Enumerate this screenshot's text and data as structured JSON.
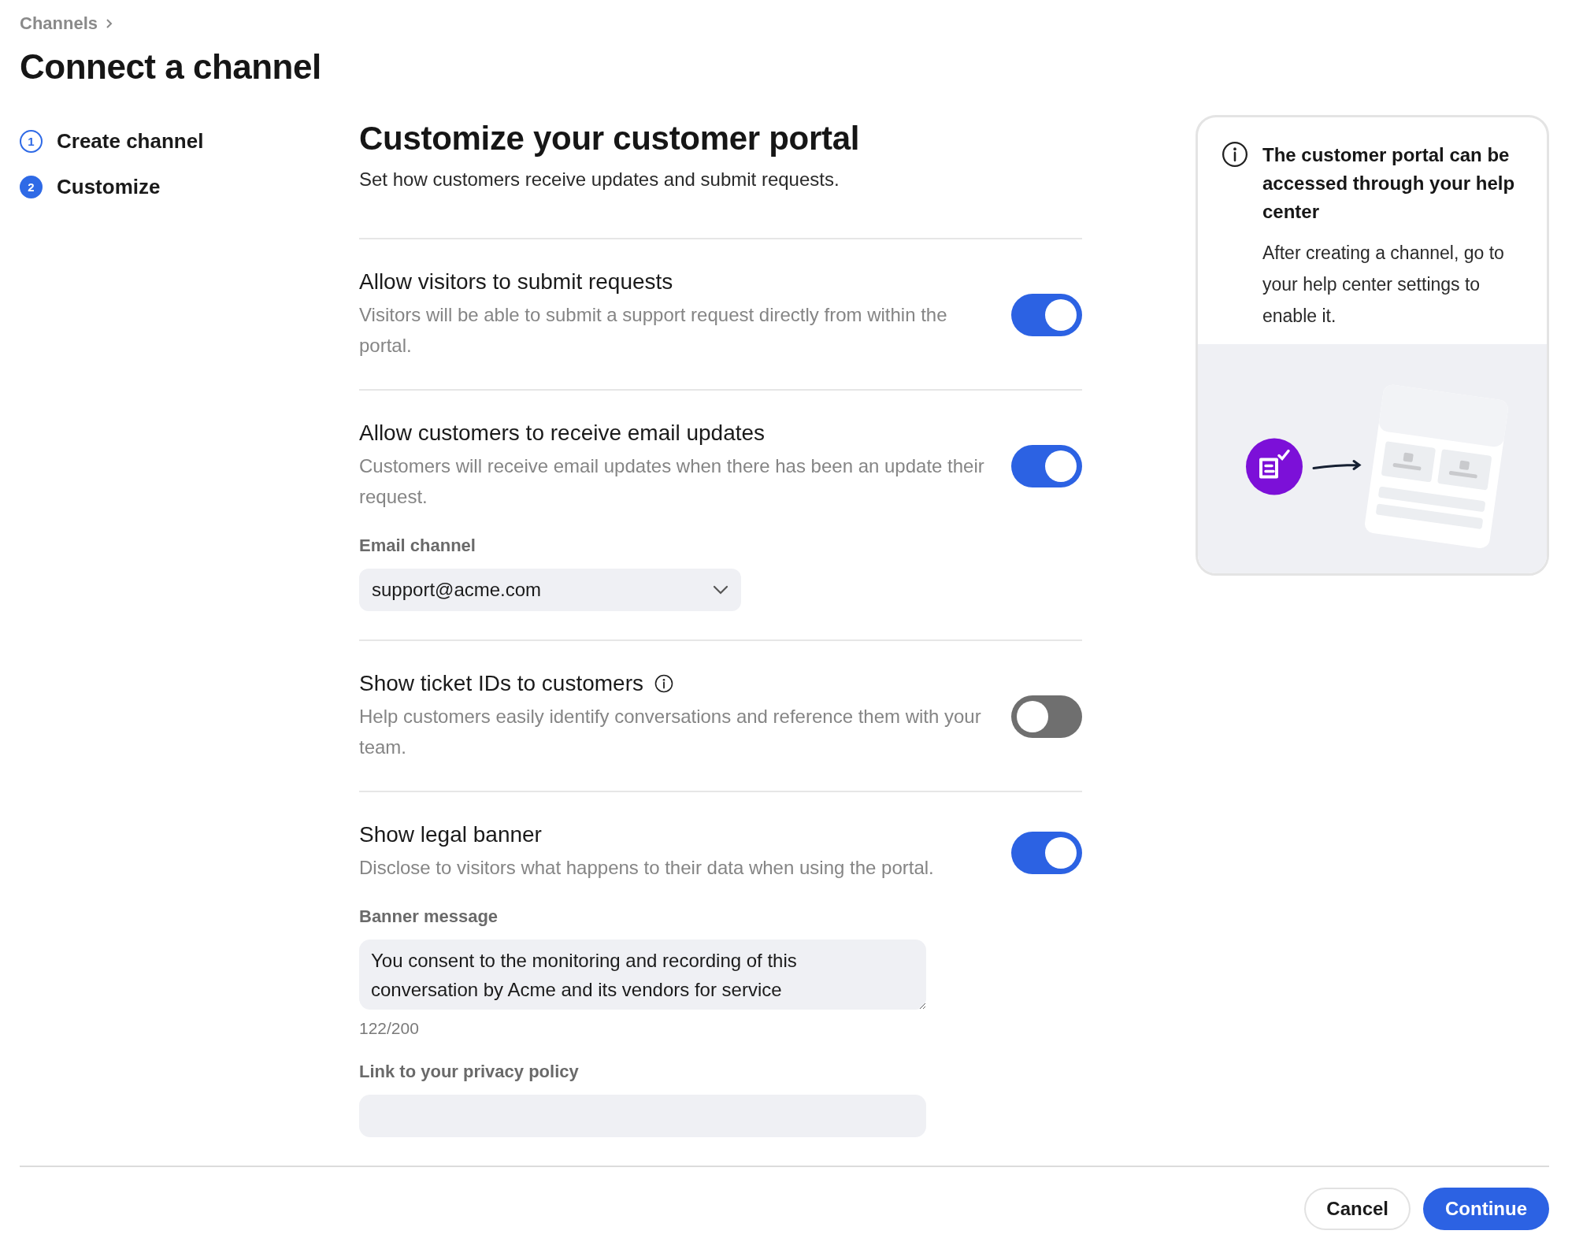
{
  "breadcrumb": {
    "label": "Channels"
  },
  "title": "Connect a channel",
  "steps": [
    {
      "number": "1",
      "label": "Create channel",
      "selected": false
    },
    {
      "number": "2",
      "label": "Customize",
      "selected": true
    }
  ],
  "main": {
    "heading": "Customize your customer portal",
    "subheading": "Set how customers receive updates and submit requests."
  },
  "settings": [
    {
      "kind": "plain",
      "title": "Allow visitors to submit requests",
      "description": "Visitors will be able to submit a support request directly from within the portal.",
      "on": true
    },
    {
      "kind": "plain",
      "title": "Allow customers to receive email updates",
      "description": "Customers will receive email updates when there has been an update their request.",
      "on": true,
      "fields": [
        {
          "kind": "select",
          "label": "Email channel",
          "value": "support@acme.com"
        }
      ]
    },
    {
      "kind": "info",
      "title": "Show ticket IDs to customers",
      "description": "Help customers easily identify conversations and reference them with your team.",
      "on": false
    },
    {
      "kind": "plain",
      "title": "Show legal banner",
      "description": "Disclose to visitors what happens to their data when using the portal.",
      "on": true,
      "fields": [
        {
          "kind": "textarea",
          "label": "Banner message",
          "value": "You consent to the monitoring and recording of this conversation by Acme and its vendors for service",
          "counter": "122/200"
        },
        {
          "kind": "input",
          "label": "Link to your privacy policy"
        }
      ]
    }
  ],
  "info_card": {
    "title": "The customer portal can be accessed through your help center",
    "body": "After creating a channel, go to your help center settings to enable it."
  },
  "footer": {
    "buttons": [
      {
        "label": "Cancel",
        "kind": "secondary"
      },
      {
        "label": "Continue",
        "kind": "primary"
      }
    ]
  }
}
